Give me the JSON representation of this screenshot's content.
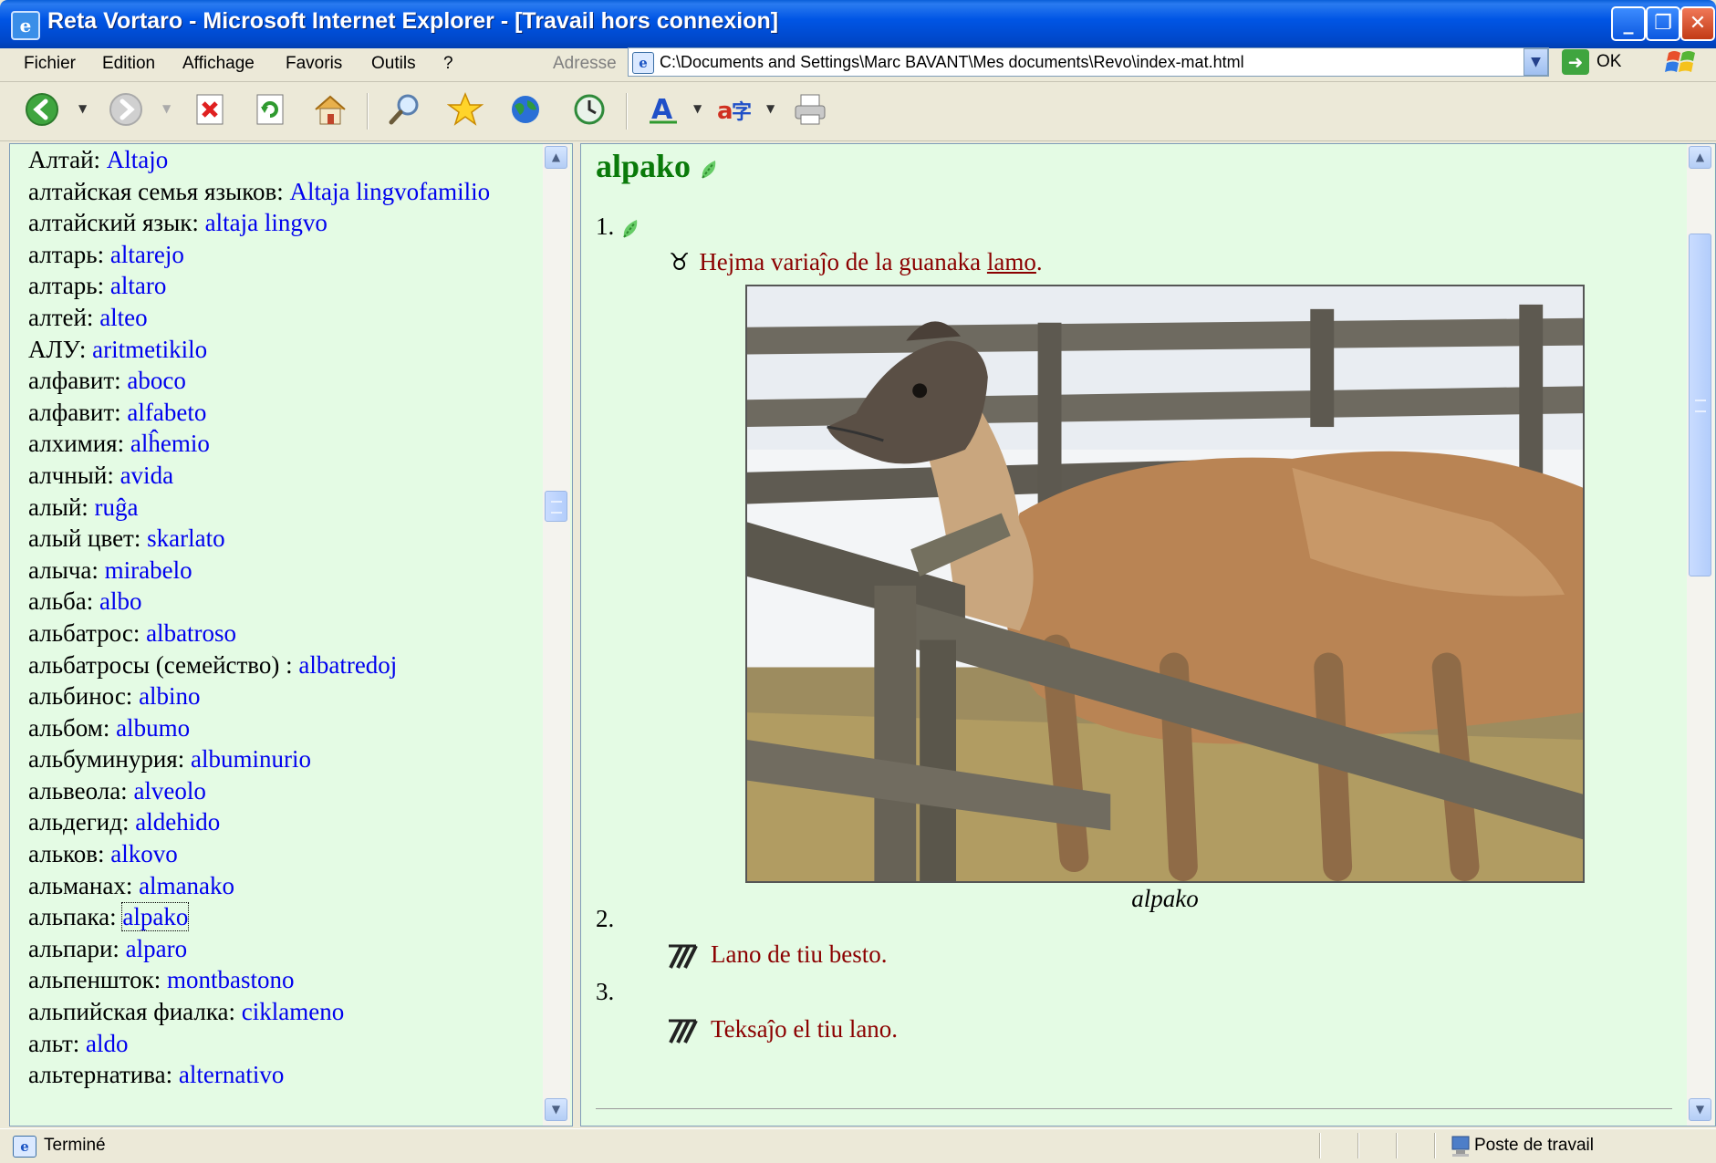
{
  "window": {
    "title": "Reta Vortaro - Microsoft Internet Explorer - [Travail hors connexion]",
    "controls": {
      "minimize": "_",
      "maximize": "❐",
      "close": "✕"
    }
  },
  "menu": {
    "items": [
      "Fichier",
      "Edition",
      "Affichage",
      "Favoris",
      "Outils",
      "?"
    ],
    "address_label": "Adresse",
    "address_value": "C:\\Documents and Settings\\Marc BAVANT\\Mes documents\\Revo\\index-mat.html",
    "go_label": "OK"
  },
  "toolbar": {
    "icons": [
      "back-icon",
      "forward-icon",
      "stop-icon",
      "refresh-icon",
      "home-icon",
      "search-icon",
      "favorites-icon",
      "media-icon",
      "history-icon",
      "font-size-icon",
      "encoding-icon",
      "print-icon"
    ]
  },
  "left_index": {
    "entries": [
      {
        "ru": "Алтай:",
        "eo": "Altajo"
      },
      {
        "ru": "алтайская семья языков:",
        "eo": "Altaja lingvofamilio"
      },
      {
        "ru": "алтайский язык:",
        "eo": "altaja lingvo"
      },
      {
        "ru": "алтарь:",
        "eo": "altarejo"
      },
      {
        "ru": "алтарь:",
        "eo": "altaro"
      },
      {
        "ru": "алтей:",
        "eo": "alteo"
      },
      {
        "ru": "АЛУ:",
        "eo": "aritmetikilo"
      },
      {
        "ru": "алфавит:",
        "eo": "aboco"
      },
      {
        "ru": "алфавит:",
        "eo": "alfabeto"
      },
      {
        "ru": "алхимия:",
        "eo": "alĥemio"
      },
      {
        "ru": "алчный:",
        "eo": "avida"
      },
      {
        "ru": "алый:",
        "eo": "ruĝa"
      },
      {
        "ru": "алый цвет:",
        "eo": "skarlato"
      },
      {
        "ru": "алыча:",
        "eo": "mirabelo"
      },
      {
        "ru": "альба:",
        "eo": "albo"
      },
      {
        "ru": "альбатрос:",
        "eo": "albatroso"
      },
      {
        "ru": "альбатросы (семейство) :",
        "eo": "albatredoj"
      },
      {
        "ru": "альбинос:",
        "eo": "albino"
      },
      {
        "ru": "альбом:",
        "eo": "albumo"
      },
      {
        "ru": "альбуминурия:",
        "eo": "albuminurio"
      },
      {
        "ru": "альвеола:",
        "eo": "alveolo"
      },
      {
        "ru": "альдегид:",
        "eo": "aldehido"
      },
      {
        "ru": "альков:",
        "eo": "alkovo"
      },
      {
        "ru": "альманах:",
        "eo": "almanako"
      },
      {
        "ru": "альпака:",
        "eo": "alpako"
      },
      {
        "ru": "альпари:",
        "eo": "alparo"
      },
      {
        "ru": "альпеншток:",
        "eo": "montbastono"
      },
      {
        "ru": "альпийская фиалка:",
        "eo": "ciklameno"
      },
      {
        "ru": "альт:",
        "eo": "aldo"
      },
      {
        "ru": "альтернатива:",
        "eo": "alternativo"
      }
    ]
  },
  "article": {
    "headword": "alpako",
    "senses": [
      {
        "num": "1.",
        "symbol": "♉",
        "text_before": "Hejma variaĵo de la guanaka ",
        "link": "lamo",
        "text_after": "."
      },
      {
        "num": "2.",
        "text": "Lano de tiu besto."
      },
      {
        "num": "3.",
        "text": "Teksaĵo el tiu lano."
      }
    ],
    "caption": "alpako"
  },
  "status": {
    "text": "Terminé",
    "zone": "Poste de travail"
  },
  "colors": {
    "pane_bg": "#e4fbe4",
    "link": "#0000ee",
    "headword": "#0a7a0a",
    "definition": "#8b0000",
    "titlebar": "#0055e5"
  }
}
